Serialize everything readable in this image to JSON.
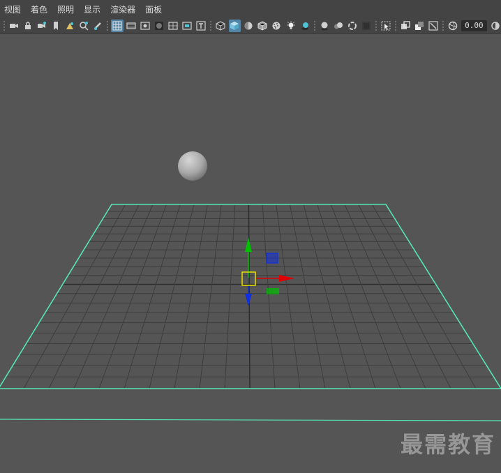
{
  "menubar": {
    "items": [
      "视图",
      "着色",
      "照明",
      "显示",
      "渲染器",
      "面板"
    ]
  },
  "toolbar": {
    "icons": [
      "camera-icon",
      "camera-lock-icon",
      "camera-attributes-icon",
      "bookmark-icon",
      "image-plane-icon",
      "2d-pan-zoom-icon",
      "grease-pencil-icon",
      "grid-icon",
      "film-gate-icon",
      "resolution-gate-icon",
      "gate-mask-icon",
      "field-chart-icon",
      "safe-action-icon",
      "safe-title-icon",
      "wireframe-icon",
      "smooth-shade-icon",
      "default-material-icon",
      "wireframe-on-shaded-icon",
      "textured-icon",
      "use-all-lights-icon",
      "shadows-icon",
      "screen-space-ambient-occlusion-icon",
      "motion-blur-icon",
      "anti-aliasing-icon",
      "depth-of-field-icon",
      "isolate-select-icon",
      "xray-icon",
      "xray-active-components-icon",
      "xray-joints-icon",
      "exposure-icon",
      "gamma-icon"
    ],
    "exposure_value": "0.00"
  },
  "viewport": {
    "colors": {
      "background": "#555555",
      "grid_line": "#3d3d3d",
      "grid_axis": "#2a2a2a",
      "plane_outline": "#55e6b4",
      "sphere": "#b4b4b4",
      "manip_x": "#e00000",
      "manip_y": "#00c000",
      "manip_z": "#1030e0",
      "manip_center": "#e8e000"
    }
  },
  "watermark": {
    "text": "最需教育"
  }
}
